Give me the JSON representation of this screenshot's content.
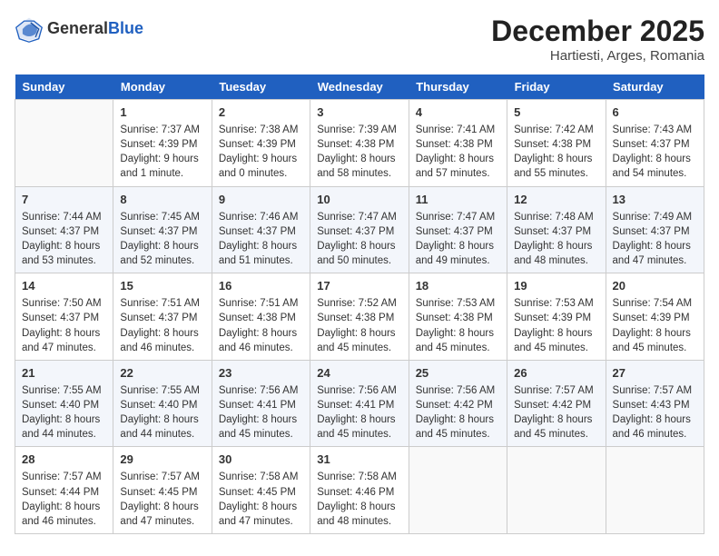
{
  "header": {
    "logo_general": "General",
    "logo_blue": "Blue",
    "month_year": "December 2025",
    "location": "Hartiesti, Arges, Romania"
  },
  "days_of_week": [
    "Sunday",
    "Monday",
    "Tuesday",
    "Wednesday",
    "Thursday",
    "Friday",
    "Saturday"
  ],
  "weeks": [
    [
      {
        "day": "",
        "data": ""
      },
      {
        "day": "1",
        "data": "Sunrise: 7:37 AM\nSunset: 4:39 PM\nDaylight: 9 hours and 1 minute."
      },
      {
        "day": "2",
        "data": "Sunrise: 7:38 AM\nSunset: 4:39 PM\nDaylight: 9 hours and 0 minutes."
      },
      {
        "day": "3",
        "data": "Sunrise: 7:39 AM\nSunset: 4:38 PM\nDaylight: 8 hours and 58 minutes."
      },
      {
        "day": "4",
        "data": "Sunrise: 7:41 AM\nSunset: 4:38 PM\nDaylight: 8 hours and 57 minutes."
      },
      {
        "day": "5",
        "data": "Sunrise: 7:42 AM\nSunset: 4:38 PM\nDaylight: 8 hours and 55 minutes."
      },
      {
        "day": "6",
        "data": "Sunrise: 7:43 AM\nSunset: 4:37 PM\nDaylight: 8 hours and 54 minutes."
      }
    ],
    [
      {
        "day": "7",
        "data": "Sunrise: 7:44 AM\nSunset: 4:37 PM\nDaylight: 8 hours and 53 minutes."
      },
      {
        "day": "8",
        "data": "Sunrise: 7:45 AM\nSunset: 4:37 PM\nDaylight: 8 hours and 52 minutes."
      },
      {
        "day": "9",
        "data": "Sunrise: 7:46 AM\nSunset: 4:37 PM\nDaylight: 8 hours and 51 minutes."
      },
      {
        "day": "10",
        "data": "Sunrise: 7:47 AM\nSunset: 4:37 PM\nDaylight: 8 hours and 50 minutes."
      },
      {
        "day": "11",
        "data": "Sunrise: 7:47 AM\nSunset: 4:37 PM\nDaylight: 8 hours and 49 minutes."
      },
      {
        "day": "12",
        "data": "Sunrise: 7:48 AM\nSunset: 4:37 PM\nDaylight: 8 hours and 48 minutes."
      },
      {
        "day": "13",
        "data": "Sunrise: 7:49 AM\nSunset: 4:37 PM\nDaylight: 8 hours and 47 minutes."
      }
    ],
    [
      {
        "day": "14",
        "data": "Sunrise: 7:50 AM\nSunset: 4:37 PM\nDaylight: 8 hours and 47 minutes."
      },
      {
        "day": "15",
        "data": "Sunrise: 7:51 AM\nSunset: 4:37 PM\nDaylight: 8 hours and 46 minutes."
      },
      {
        "day": "16",
        "data": "Sunrise: 7:51 AM\nSunset: 4:38 PM\nDaylight: 8 hours and 46 minutes."
      },
      {
        "day": "17",
        "data": "Sunrise: 7:52 AM\nSunset: 4:38 PM\nDaylight: 8 hours and 45 minutes."
      },
      {
        "day": "18",
        "data": "Sunrise: 7:53 AM\nSunset: 4:38 PM\nDaylight: 8 hours and 45 minutes."
      },
      {
        "day": "19",
        "data": "Sunrise: 7:53 AM\nSunset: 4:39 PM\nDaylight: 8 hours and 45 minutes."
      },
      {
        "day": "20",
        "data": "Sunrise: 7:54 AM\nSunset: 4:39 PM\nDaylight: 8 hours and 45 minutes."
      }
    ],
    [
      {
        "day": "21",
        "data": "Sunrise: 7:55 AM\nSunset: 4:40 PM\nDaylight: 8 hours and 44 minutes."
      },
      {
        "day": "22",
        "data": "Sunrise: 7:55 AM\nSunset: 4:40 PM\nDaylight: 8 hours and 44 minutes."
      },
      {
        "day": "23",
        "data": "Sunrise: 7:56 AM\nSunset: 4:41 PM\nDaylight: 8 hours and 45 minutes."
      },
      {
        "day": "24",
        "data": "Sunrise: 7:56 AM\nSunset: 4:41 PM\nDaylight: 8 hours and 45 minutes."
      },
      {
        "day": "25",
        "data": "Sunrise: 7:56 AM\nSunset: 4:42 PM\nDaylight: 8 hours and 45 minutes."
      },
      {
        "day": "26",
        "data": "Sunrise: 7:57 AM\nSunset: 4:42 PM\nDaylight: 8 hours and 45 minutes."
      },
      {
        "day": "27",
        "data": "Sunrise: 7:57 AM\nSunset: 4:43 PM\nDaylight: 8 hours and 46 minutes."
      }
    ],
    [
      {
        "day": "28",
        "data": "Sunrise: 7:57 AM\nSunset: 4:44 PM\nDaylight: 8 hours and 46 minutes."
      },
      {
        "day": "29",
        "data": "Sunrise: 7:57 AM\nSunset: 4:45 PM\nDaylight: 8 hours and 47 minutes."
      },
      {
        "day": "30",
        "data": "Sunrise: 7:58 AM\nSunset: 4:45 PM\nDaylight: 8 hours and 47 minutes."
      },
      {
        "day": "31",
        "data": "Sunrise: 7:58 AM\nSunset: 4:46 PM\nDaylight: 8 hours and 48 minutes."
      },
      {
        "day": "",
        "data": ""
      },
      {
        "day": "",
        "data": ""
      },
      {
        "day": "",
        "data": ""
      }
    ]
  ]
}
